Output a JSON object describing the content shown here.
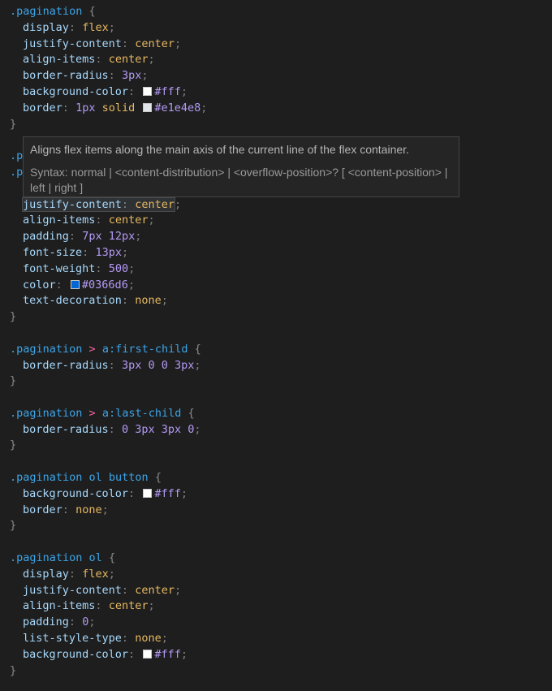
{
  "colors": {
    "background": "#1e1e1e",
    "selector": "#3ba4e8",
    "property": "#a7d8fb",
    "value": "#e7b862",
    "number": "#b49af5",
    "combinator": "#f0639e",
    "swatch_white": "#ffffff",
    "swatch_border": "#e1e4e8",
    "swatch_blue": "#0366d6"
  },
  "hover": {
    "description": "Aligns flex items along the main axis of the current line of the flex container.",
    "syntax": "Syntax: normal | <content-distribution> | <overflow-position>? [ <content-position> | left | right ]"
  },
  "code": {
    "r1_sel": ".pagination",
    "r1_p1": "display",
    "r1_v1": "flex",
    "r1_p2": "justify-content",
    "r1_v2": "center",
    "r1_p3": "align-items",
    "r1_v3": "center",
    "r1_p4": "border-radius",
    "r1_v4": "3px",
    "r1_p5": "background-color",
    "r1_v5": "#fff",
    "r1_p6": "border",
    "r1_v6a": "1px",
    "r1_v6b": "solid",
    "r1_v6c": "#e1e4e8",
    "r2_frag1": ".p",
    "r2_frag2": ".p",
    "r2_p1": "justify-content",
    "r2_v1": "center",
    "r2_p2": "align-items",
    "r2_v2": "center",
    "r2_p3": "padding",
    "r2_v3": "7px 12px",
    "r2_p4": "font-size",
    "r2_v4": "13px",
    "r2_p5": "font-weight",
    "r2_v5": "500",
    "r2_p6": "color",
    "r2_v6": "#0366d6",
    "r2_p7": "text-decoration",
    "r2_v7": "none",
    "r3_sel": ".pagination",
    "r3_comb": ">",
    "r3_el": "a",
    "r3_pseudo": ":first-child",
    "r3_p1": "border-radius",
    "r3_v1": "3px 0 0 3px",
    "r4_sel": ".pagination",
    "r4_comb": ">",
    "r4_el": "a",
    "r4_pseudo": ":last-child",
    "r4_p1": "border-radius",
    "r4_v1": "0 3px 3px 0",
    "r5_sel": ".pagination ol button",
    "r5_p1": "background-color",
    "r5_v1": "#fff",
    "r5_p2": "border",
    "r5_v2": "none",
    "r6_sel": ".pagination ol",
    "r6_p1": "display",
    "r6_v1": "flex",
    "r6_p2": "justify-content",
    "r6_v2": "center",
    "r6_p3": "align-items",
    "r6_v3": "center",
    "r6_p4": "padding",
    "r6_v4": "0",
    "r6_p5": "list-style-type",
    "r6_v5": "none",
    "r6_p6": "background-color",
    "r6_v6": "#fff",
    "open": "{",
    "close": "}",
    "colon": ":",
    "semi": ";"
  }
}
